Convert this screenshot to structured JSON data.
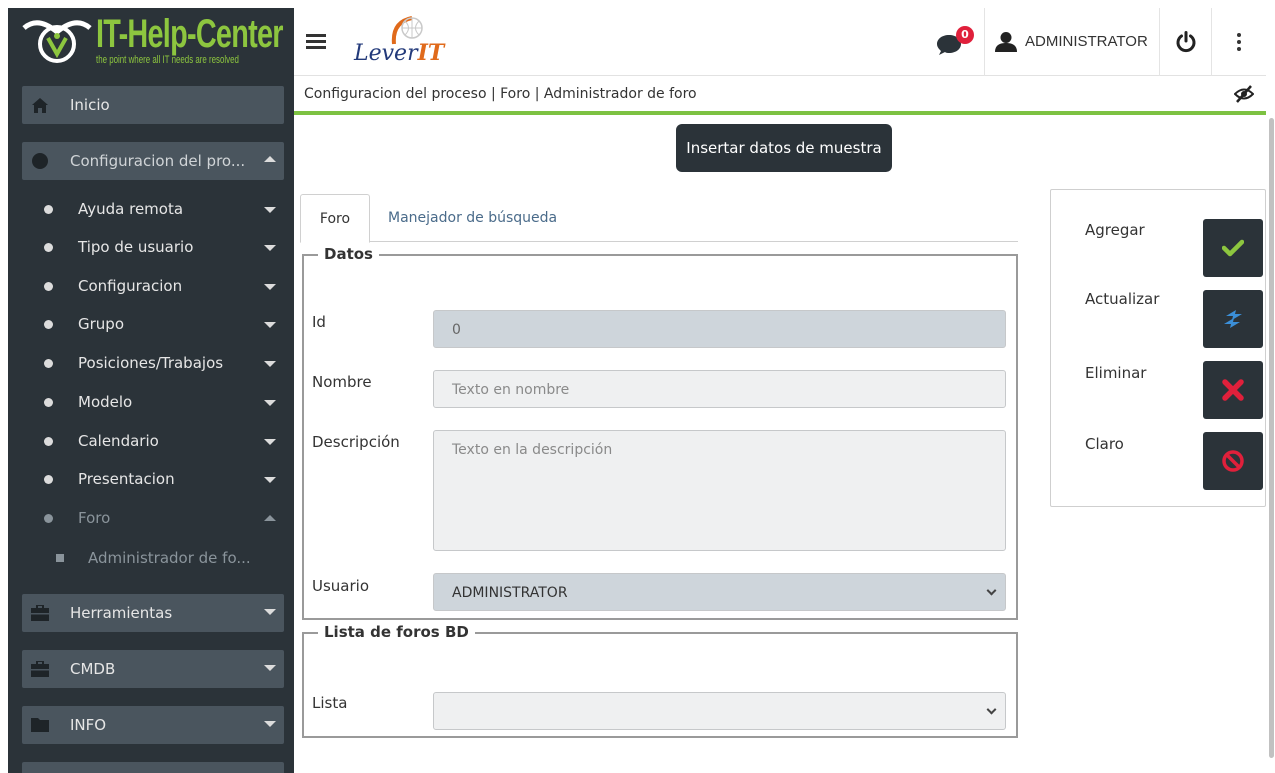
{
  "logo": {
    "title": "IT-Help-Center",
    "tagline": "the point where all IT needs are resolved"
  },
  "sidebar": {
    "top_items": [
      {
        "label": "Inicio",
        "icon": "home-icon"
      },
      {
        "label": "Configuracion del pro...",
        "icon": "circle-icon"
      },
      {
        "label": "Herramientas",
        "icon": "briefcase-icon"
      },
      {
        "label": "CMDB",
        "icon": "briefcase-icon"
      },
      {
        "label": "INFO",
        "icon": "folder-icon"
      }
    ],
    "sub_items": [
      {
        "label": "Ayuda remota"
      },
      {
        "label": "Tipo de usuario"
      },
      {
        "label": "Configuracion"
      },
      {
        "label": "Grupo"
      },
      {
        "label": "Posiciones/Trabajos"
      },
      {
        "label": "Modelo"
      },
      {
        "label": "Calendario"
      },
      {
        "label": "Presentacion"
      },
      {
        "label": "Foro"
      }
    ],
    "sub_sub_item": "Administrador de fo..."
  },
  "header": {
    "brand": "Lever",
    "brand_suffix": "IT",
    "notification_count": "0",
    "user_name": "ADMINISTRATOR"
  },
  "breadcrumb": "Configuracion del proceso | Foro | Administrador de foro",
  "sample_button": "Insertar datos de muestra",
  "tabs": {
    "active": "Foro",
    "other": "Manejador de búsqueda"
  },
  "form": {
    "legend": "Datos",
    "id_label": "Id",
    "id_value": "0",
    "nombre_label": "Nombre",
    "nombre_placeholder": "Texto en nombre",
    "descripcion_label": "Descripción",
    "descripcion_placeholder": "Texto en la descripción",
    "usuario_label": "Usuario",
    "usuario_value": "ADMINISTRATOR"
  },
  "list_section": {
    "legend": "Lista de foros BD",
    "lista_label": "Lista",
    "lista_value": ""
  },
  "actions": {
    "add": "Agregar",
    "update": "Actualizar",
    "delete": "Eliminar",
    "clear": "Claro"
  },
  "colors": {
    "sidebar_bg": "#2b3339",
    "accent_green": "#7dc242",
    "check_green": "#8dc63f",
    "delete_red": "#e0203b",
    "update_blue": "#3b8fd8"
  }
}
